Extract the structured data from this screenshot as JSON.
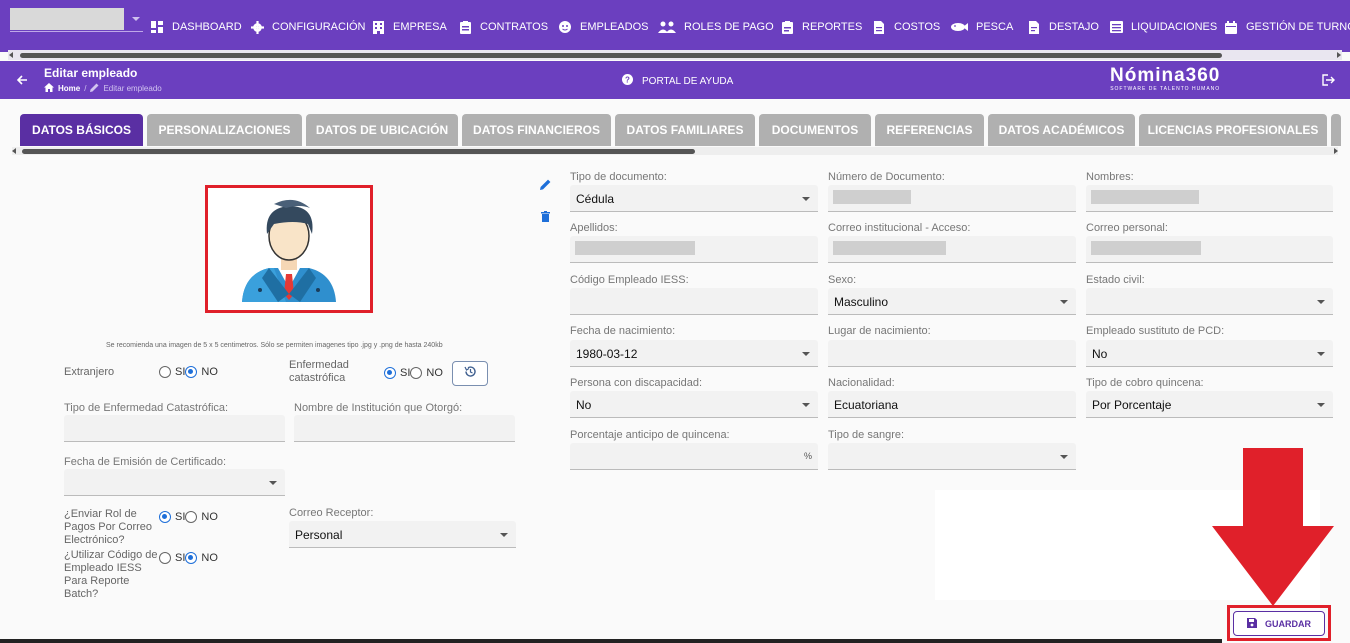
{
  "topnav": {
    "menu": [
      {
        "label": "DASHBOARD",
        "icon": "dashboard-icon"
      },
      {
        "label": "CONFIGURACIÓN",
        "icon": "gear-icon"
      },
      {
        "label": "EMPRESA",
        "icon": "building-icon"
      },
      {
        "label": "CONTRATOS",
        "icon": "clipboard-icon"
      },
      {
        "label": "EMPLEADOS",
        "icon": "face-icon"
      },
      {
        "label": "ROLES DE PAGO",
        "icon": "people-icon"
      },
      {
        "label": "REPORTES",
        "icon": "report-icon"
      },
      {
        "label": "COSTOS",
        "icon": "document-icon"
      },
      {
        "label": "PESCA",
        "icon": "fish-icon"
      },
      {
        "label": "DESTAJO",
        "icon": "file-icon"
      },
      {
        "label": "LIQUIDACIONES",
        "icon": "list-icon"
      },
      {
        "label": "GESTIÓN DE TURNOS",
        "icon": "calendar-icon"
      }
    ]
  },
  "header": {
    "title": "Editar empleado",
    "breadcrumb_home": "Home",
    "breadcrumb_current": "Editar empleado",
    "help": "PORTAL DE AYUDA",
    "logo_main": "Nómina360",
    "logo_sub": "SOFTWARE DE TALENTO HUMANO"
  },
  "tabs": [
    {
      "label": "DATOS BÁSICOS",
      "active": true
    },
    {
      "label": "PERSONALIZACIONES",
      "active": false
    },
    {
      "label": "DATOS DE UBICACIÓN",
      "active": false
    },
    {
      "label": "DATOS FINANCIEROS",
      "active": false
    },
    {
      "label": "DATOS FAMILIARES",
      "active": false
    },
    {
      "label": "DOCUMENTOS",
      "active": false
    },
    {
      "label": "REFERENCIAS",
      "active": false
    },
    {
      "label": "DATOS ACADÉMICOS",
      "active": false
    },
    {
      "label": "LICENCIAS PROFESIONALES",
      "active": false
    }
  ],
  "left": {
    "photo_note": "Se recomienda una imagen de 5 x 5 centimetros. Sólo se permiten imagenes tipo .jpg y .png de hasta 240kb",
    "extranjero": {
      "label": "Extranjero",
      "yes": "SI",
      "no": "NO",
      "selected": "NO"
    },
    "enfermedad": {
      "label1": "Enfermedad",
      "label2": "catastrófica",
      "yes": "SI",
      "no": "NO",
      "selected": "SI"
    },
    "tipo_enfermedad": {
      "label": "Tipo de Enfermedad Catastrófica:",
      "value": ""
    },
    "institucion": {
      "label": "Nombre de Institución que Otorgó:",
      "value": ""
    },
    "fecha_emision": {
      "label": "Fecha de Emisión de Certificado:",
      "value": ""
    },
    "enviar_rol": {
      "l1": "¿Enviar Rol de",
      "l2": "Pagos Por Correo",
      "l3": "Electrónico?",
      "yes": "SI",
      "no": "NO",
      "selected": "SI"
    },
    "correo_receptor": {
      "label": "Correo Receptor:",
      "value": "Personal"
    },
    "codigo_iess": {
      "l1": "¿Utilizar Código de",
      "l2": "Empleado IESS",
      "l3": "Para Reporte",
      "l4": "Batch?",
      "yes": "SI",
      "no": "NO",
      "selected": "NO"
    }
  },
  "form": {
    "tipo_documento": {
      "label": "Tipo de documento:",
      "value": "Cédula"
    },
    "numero_documento": {
      "label": "Número de Documento:"
    },
    "nombres": {
      "label": "Nombres:"
    },
    "apellidos": {
      "label": "Apellidos:"
    },
    "correo_institucional": {
      "label": "Correo institucional - Acceso:"
    },
    "correo_personal": {
      "label": "Correo personal:"
    },
    "codigo_iess": {
      "label": "Código Empleado IESS:",
      "value": ""
    },
    "sexo": {
      "label": "Sexo:",
      "value": "Masculino"
    },
    "estado_civil": {
      "label": "Estado civil:",
      "value": ""
    },
    "fecha_nacimiento": {
      "label": "Fecha de nacimiento:",
      "value": "1980-03-12"
    },
    "lugar_nacimiento": {
      "label": "Lugar de nacimiento:",
      "value": ""
    },
    "sustituto_pcd": {
      "label": "Empleado sustituto de PCD:",
      "value": "No"
    },
    "discapacidad": {
      "label": "Persona con discapacidad:",
      "value": "No"
    },
    "nacionalidad": {
      "label": "Nacionalidad:",
      "value": "Ecuatoriana"
    },
    "cobro_quincena": {
      "label": "Tipo de cobro quincena:",
      "value": "Por Porcentaje"
    },
    "porcentaje_quincena": {
      "label": "Porcentaje anticipo de quincena:",
      "value": "",
      "suffix": "%"
    },
    "tipo_sangre": {
      "label": "Tipo de sangre:",
      "value": ""
    }
  },
  "actions": {
    "save": "GUARDAR"
  },
  "colors": {
    "primary": "#6b3fbf",
    "active_tab": "#5a2fa3",
    "annotation": "#e0202a",
    "radio": "#1e6fd9"
  }
}
